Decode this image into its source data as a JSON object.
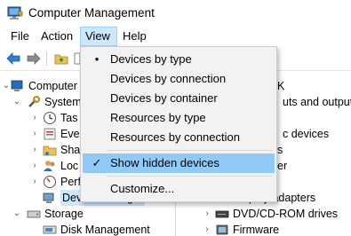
{
  "window": {
    "title": "Computer Management"
  },
  "menubar": {
    "items": [
      "File",
      "Action",
      "View",
      "Help"
    ]
  },
  "view_menu": {
    "items": [
      {
        "label": "Devices by type",
        "mark": "•"
      },
      {
        "label": "Devices by connection",
        "mark": ""
      },
      {
        "label": "Devices by container",
        "mark": ""
      },
      {
        "label": "Resources by type",
        "mark": ""
      },
      {
        "label": "Resources by connection",
        "mark": ""
      },
      {
        "label": "Show hidden devices",
        "mark": "✓"
      },
      {
        "label": "Customize...",
        "mark": ""
      }
    ]
  },
  "tree": {
    "root": "Computer",
    "system": "System",
    "task": "Tas",
    "event": "Eve",
    "shared": "Sha",
    "local": "Loc",
    "perf": "Perf",
    "device": "Device Manager",
    "storage": "Storage",
    "disk": "Disk Management"
  },
  "devices": {
    "header_fragment": "K",
    "audio_fragment": "uts and outputs",
    "devices_fragment": "c devices",
    "r3": "s",
    "r4": "er",
    "display_fragment": "Display adapters",
    "dvd": "DVD/CD-ROM drives",
    "firmware": "Firmware"
  },
  "colors": {
    "menu_highlight": "#91c9f7",
    "menu_active": "#cce8ff",
    "menu_bg": "#f2f2f2"
  }
}
